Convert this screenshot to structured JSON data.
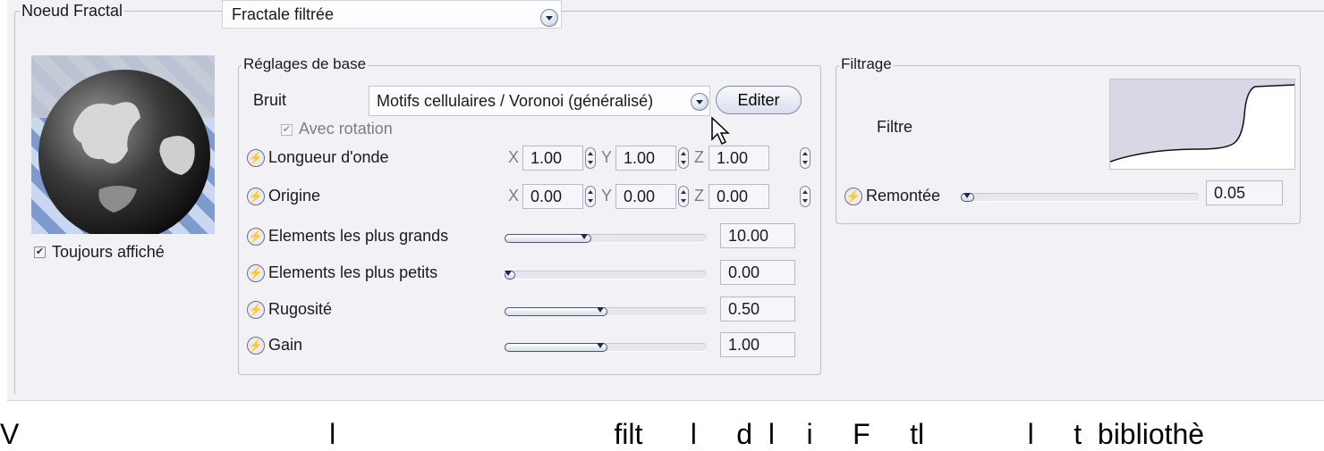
{
  "node": {
    "title": "Noeud Fractal",
    "type_value": "Fractale filtrée",
    "preview_checkbox_label": "Toujours affiché",
    "preview_checked": true
  },
  "basic_settings": {
    "title": "Réglages de base",
    "noise_label": "Bruit",
    "noise_value": "Motifs cellulaires / Voronoi (généralisé)",
    "edit_button": "Editer",
    "rotation_label": "Avec rotation",
    "rotation_checked": true,
    "wavelength": {
      "label": "Longueur d'onde",
      "x_label": "X",
      "x": "1.00",
      "y_label": "Y",
      "y": "1.00",
      "z_label": "Z",
      "z": "1.00"
    },
    "origin": {
      "label": "Origine",
      "x_label": "X",
      "x": "0.00",
      "y_label": "Y",
      "y": "0.00",
      "z_label": "Z",
      "z": "0.00"
    },
    "sliders": [
      {
        "label": "Elements les plus grands",
        "value": "10.00",
        "level": 0.42
      },
      {
        "label": "Elements les plus petits",
        "value": "0.00",
        "level": 0.0
      },
      {
        "label": "Rugosité",
        "value": "0.50",
        "level": 0.5
      },
      {
        "label": "Gain",
        "value": "1.00",
        "level": 0.5
      }
    ]
  },
  "filtering": {
    "title": "Filtrage",
    "filter_label": "Filtre",
    "rise_label": "Remontée",
    "rise_value": "0.05",
    "rise_level": 0.05
  },
  "caption": {
    "text": "V                                       l                                   filt      l     d  l    i     F     tl             l     t  bibliothè"
  },
  "colors": {
    "panel": "#f2f1f6",
    "border": "#bfbfcc",
    "accent": "#1e2a55"
  }
}
